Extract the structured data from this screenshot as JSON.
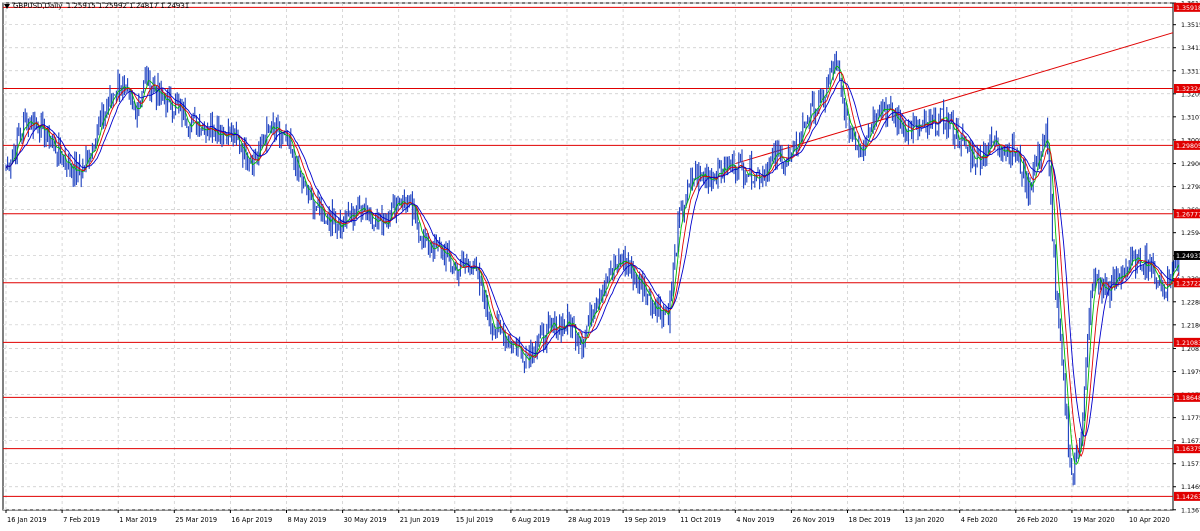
{
  "header": {
    "symbol": "GBPUSD,Daily",
    "ohlc": "1.25915 1.25992 1.24817 1.24931"
  },
  "chart_data": {
    "type": "candlestick",
    "title": "GBPUSD,Daily",
    "ylim": [
      1.1366,
      1.3611
    ],
    "y_ticks": [
      "1.36110",
      "1.35150",
      "1.34130",
      "1.33110",
      "1.32090",
      "1.31070",
      "1.30050",
      "1.29000",
      "1.27980",
      "1.26960",
      "1.25940",
      "1.24920",
      "1.23900",
      "1.22880",
      "1.21860",
      "1.20810",
      "1.19790",
      "1.18770",
      "1.17750",
      "1.16730",
      "1.15710",
      "1.14690",
      "1.13670"
    ],
    "x_labels": [
      "16 Jan 2019",
      "7 Feb 2019",
      "1 Mar 2019",
      "25 Mar 2019",
      "16 Apr 2019",
      "8 May 2019",
      "30 May 2019",
      "21 Jun 2019",
      "15 Jul 2019",
      "6 Aug 2019",
      "28 Aug 2019",
      "19 Sep 2019",
      "11 Oct 2019",
      "4 Nov 2019",
      "26 Nov 2019",
      "18 Dec 2019",
      "13 Jan 2020",
      "4 Feb 2020",
      "26 Feb 2020",
      "19 Mar 2020",
      "10 Apr 2020"
    ],
    "current_price": "1.24931",
    "horizontal_levels": [
      {
        "label": "1.35918",
        "value": 1.35918
      },
      {
        "label": "1.32324",
        "value": 1.32324
      },
      {
        "label": "1.29805",
        "value": 1.29805
      },
      {
        "label": "1.26777",
        "value": 1.26777
      },
      {
        "label": "1.23722",
        "value": 1.23722
      },
      {
        "label": "1.21083",
        "value": 1.21083
      },
      {
        "label": "1.18648",
        "value": 1.18648
      },
      {
        "label": "1.16375",
        "value": 1.16375
      },
      {
        "label": "1.14263",
        "value": 1.14263
      }
    ],
    "trendline": {
      "from": [
        "4 Nov 2019",
        1.29
      ],
      "to": [
        "10 Apr 2020",
        1.342
      ]
    },
    "price_path": [
      [
        "16 Jan 2019",
        1.288
      ],
      [
        "24 Jan 2019",
        1.31
      ],
      [
        "29 Jan 2019",
        1.307
      ],
      [
        "7 Feb 2019",
        1.293
      ],
      [
        "14 Feb 2019",
        1.285
      ],
      [
        "21 Feb 2019",
        1.305
      ],
      [
        "1 Mar 2019",
        1.326
      ],
      [
        "8 Mar 2019",
        1.313
      ],
      [
        "13 Mar 2019",
        1.328
      ],
      [
        "20 Mar 2019",
        1.318
      ],
      [
        "25 Mar 2019",
        1.316
      ],
      [
        "1 Apr 2019",
        1.308
      ],
      [
        "8 Apr 2019",
        1.307
      ],
      [
        "16 Apr 2019",
        1.303
      ],
      [
        "25 Apr 2019",
        1.291
      ],
      [
        "1 May 2019",
        1.305
      ],
      [
        "8 May 2019",
        1.3
      ],
      [
        "16 May 2019",
        1.276
      ],
      [
        "22 May 2019",
        1.268
      ],
      [
        "30 May 2019",
        1.263
      ],
      [
        "7 Jun 2019",
        1.272
      ],
      [
        "14 Jun 2019",
        1.263
      ],
      [
        "21 Jun 2019",
        1.275
      ],
      [
        "26 Jun 2019",
        1.27
      ],
      [
        "3 Jul 2019",
        1.254
      ],
      [
        "10 Jul 2019",
        1.251
      ],
      [
        "15 Jul 2019",
        1.243
      ],
      [
        "22 Jul 2019",
        1.246
      ],
      [
        "30 Jul 2019",
        1.218
      ],
      [
        "6 Aug 2019",
        1.211
      ],
      [
        "12 Aug 2019",
        1.205
      ],
      [
        "20 Aug 2019",
        1.215
      ],
      [
        "28 Aug 2019",
        1.22
      ],
      [
        "3 Sep 2019",
        1.212
      ],
      [
        "10 Sep 2019",
        1.235
      ],
      [
        "19 Sep 2019",
        1.248
      ],
      [
        "24 Sep 2019",
        1.24
      ],
      [
        "1 Oct 2019",
        1.228
      ],
      [
        "7 Oct 2019",
        1.224
      ],
      [
        "11 Oct 2019",
        1.266
      ],
      [
        "17 Oct 2019",
        1.284
      ],
      [
        "25 Oct 2019",
        1.285
      ],
      [
        "4 Nov 2019",
        1.29
      ],
      [
        "13 Nov 2019",
        1.285
      ],
      [
        "20 Nov 2019",
        1.293
      ],
      [
        "26 Nov 2019",
        1.292
      ],
      [
        "2 Dec 2019",
        1.31
      ],
      [
        "9 Dec 2019",
        1.32
      ],
      [
        "13 Dec 2019",
        1.335
      ],
      [
        "18 Dec 2019",
        1.307
      ],
      [
        "24 Dec 2019",
        1.297
      ],
      [
        "2 Jan 2020",
        1.317
      ],
      [
        "13 Jan 2020",
        1.306
      ],
      [
        "20 Jan 2020",
        1.305
      ],
      [
        "29 Jan 2020",
        1.31
      ],
      [
        "4 Feb 2020",
        1.301
      ],
      [
        "10 Feb 2020",
        1.292
      ],
      [
        "18 Feb 2020",
        1.3
      ],
      [
        "26 Feb 2020",
        1.295
      ],
      [
        "2 Mar 2020",
        1.279
      ],
      [
        "9 Mar 2020",
        1.305
      ],
      [
        "13 Mar 2020",
        1.228
      ],
      [
        "19 Mar 2020",
        1.15
      ],
      [
        "23 Mar 2020",
        1.175
      ],
      [
        "27 Mar 2020",
        1.24
      ],
      [
        "2 Apr 2020",
        1.233
      ],
      [
        "10 Apr 2020",
        1.245
      ],
      [
        "17 Apr 2020",
        1.248
      ],
      [
        "24 Apr 2020",
        1.234
      ],
      [
        "30 Apr 2020",
        1.249
      ]
    ],
    "moving_averages": [
      {
        "color": "#00bb00"
      },
      {
        "color": "#e00000"
      },
      {
        "color": "#0000cc"
      }
    ],
    "grid": "dashed"
  },
  "colors": {
    "candle": "#1a3fbf",
    "level": "#e00000",
    "label_bg": "#e00000",
    "current_bg": "#000000",
    "grid": "#c8c8c8"
  }
}
